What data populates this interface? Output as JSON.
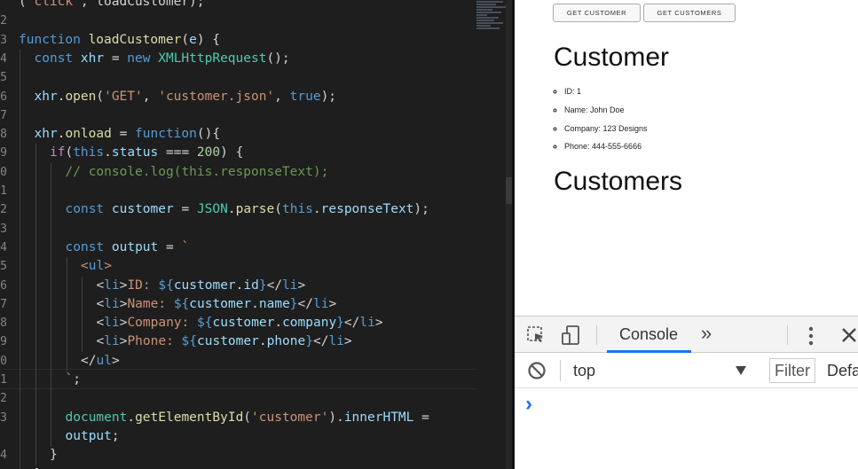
{
  "editor": {
    "lines": [
      {
        "num": "",
        "indent": 0,
        "html": "<span class='pl'>(</span><span class='str'>'click'</span><span class='pl'>, loadCustomer);</span>"
      },
      {
        "num": "2",
        "indent": 0,
        "html": ""
      },
      {
        "num": "3",
        "indent": 0,
        "html": "<span class='kw'>function</span> <span class='fn'>loadCustomer</span><span class='pl'>(</span><span class='var'>e</span><span class='pl'>) {</span>"
      },
      {
        "num": "4",
        "indent": 1,
        "html": "<span class='kw'>const</span> <span class='var'>xhr</span> <span class='pl'>=</span> <span class='kw'>new</span> <span class='cls'>XMLHttpRequest</span><span class='pl'>();</span>"
      },
      {
        "num": "5",
        "indent": 1,
        "html": ""
      },
      {
        "num": "6",
        "indent": 1,
        "html": "<span class='var'>xhr</span><span class='pl'>.</span><span class='fn'>open</span><span class='pl'>(</span><span class='str'>'GET'</span><span class='pl'>, </span><span class='str'>'customer.json'</span><span class='pl'>, </span><span class='kw'>true</span><span class='pl'>);</span>"
      },
      {
        "num": "7",
        "indent": 1,
        "html": ""
      },
      {
        "num": "8",
        "indent": 1,
        "html": "<span class='var'>xhr</span><span class='pl'>.</span><span class='fn'>onload</span> <span class='pl'>=</span> <span class='kw'>function</span><span class='pl'>(){</span>"
      },
      {
        "num": "9",
        "indent": 2,
        "html": "<span class='ctrl'>if</span><span class='pl'>(</span><span class='kw'>this</span><span class='pl'>.</span><span class='var'>status</span> <span class='pl'>===</span> <span class='num'>200</span><span class='pl'>) {</span>"
      },
      {
        "num": "0",
        "indent": 3,
        "html": "<span class='cm'>// console.log(this.responseText);</span>"
      },
      {
        "num": "1",
        "indent": 3,
        "html": ""
      },
      {
        "num": "2",
        "indent": 3,
        "html": "<span class='kw'>const</span> <span class='var'>customer</span> <span class='pl'>=</span> <span class='cls'>JSON</span><span class='pl'>.</span><span class='fn'>parse</span><span class='pl'>(</span><span class='kw'>this</span><span class='pl'>.</span><span class='var'>responseText</span><span class='pl'>);</span>"
      },
      {
        "num": "3",
        "indent": 3,
        "html": ""
      },
      {
        "num": "4",
        "indent": 3,
        "html": "<span class='kw'>const</span> <span class='var'>output</span> <span class='pl'>=</span> <span class='str'>`</span>"
      },
      {
        "num": "5",
        "indent": 4,
        "html": "<span class='str'>&lt;</span><span class='tag'>ul</span><span class='str'>&gt;</span>"
      },
      {
        "num": "6",
        "indent": 5,
        "html": "<span class='pl'>&lt;</span><span class='tag'>li</span><span class='pl'>&gt;</span><span class='str'>ID: </span><span class='kw'>${</span><span class='var'>customer</span><span class='pl'>.</span><span class='var'>id</span><span class='kw'>}</span><span class='pl'>&lt;/</span><span class='tag'>li</span><span class='pl'>&gt;</span>"
      },
      {
        "num": "7",
        "indent": 5,
        "html": "<span class='pl'>&lt;</span><span class='tag'>li</span><span class='pl'>&gt;</span><span class='str'>Name: </span><span class='kw'>${</span><span class='var'>customer</span><span class='pl'>.</span><span class='var'>name</span><span class='kw'>}</span><span class='pl'>&lt;/</span><span class='tag'>li</span><span class='pl'>&gt;</span>"
      },
      {
        "num": "8",
        "indent": 5,
        "html": "<span class='pl'>&lt;</span><span class='tag'>li</span><span class='pl'>&gt;</span><span class='str'>Company: </span><span class='kw'>${</span><span class='var'>customer</span><span class='pl'>.</span><span class='var'>company</span><span class='kw'>}</span><span class='pl'>&lt;/</span><span class='tag'>li</span><span class='pl'>&gt;</span>"
      },
      {
        "num": "9",
        "indent": 5,
        "html": "<span class='pl'>&lt;</span><span class='tag'>li</span><span class='pl'>&gt;</span><span class='str'>Phone: </span><span class='kw'>${</span><span class='var'>customer</span><span class='pl'>.</span><span class='var'>phone</span><span class='kw'>}</span><span class='pl'>&lt;/</span><span class='tag'>li</span><span class='pl'>&gt;</span>"
      },
      {
        "num": "0",
        "indent": 4,
        "html": "<span class='pl'>&lt;/</span><span class='tag'>ul</span><span class='pl'>&gt;</span>"
      },
      {
        "num": "1",
        "indent": 3,
        "html": "<span class='str'>`</span><span class='pl'>;</span>"
      },
      {
        "num": "2",
        "indent": 3,
        "html": ""
      },
      {
        "num": "3",
        "indent": 3,
        "html": "<span class='cls'>document</span><span class='pl'>.</span><span class='fn'>getElementById</span><span class='pl'>(</span><span class='str'>'customer'</span><span class='pl'>).</span><span class='var'>innerHTML</span> <span class='pl'>=</span>"
      },
      {
        "num": "",
        "indent": 3,
        "html": "<span class='var'>output</span><span class='pl'>;</span>"
      },
      {
        "num": "4",
        "indent": 2,
        "html": "<span class='pl'>}</span>"
      },
      {
        "num": "",
        "indent": 1,
        "html": "<span class='pl'>}</span>"
      }
    ]
  },
  "page": {
    "get_customer_btn": "GET CUSTOMER",
    "get_customers_btn": "GET CUSTOMERS",
    "customer_heading": "Customer",
    "customer_items": [
      "ID: 1",
      "Name: John Doe",
      "Company: 123 Designs",
      "Phone: 444-555-6666"
    ],
    "customers_heading": "Customers"
  },
  "devtools": {
    "console_tab": "Console",
    "more_tabs": "»",
    "context": "top",
    "filter_placeholder": "Filter",
    "levels_label": "Defa",
    "prompt": "›",
    "accent": "#1a73e8"
  }
}
